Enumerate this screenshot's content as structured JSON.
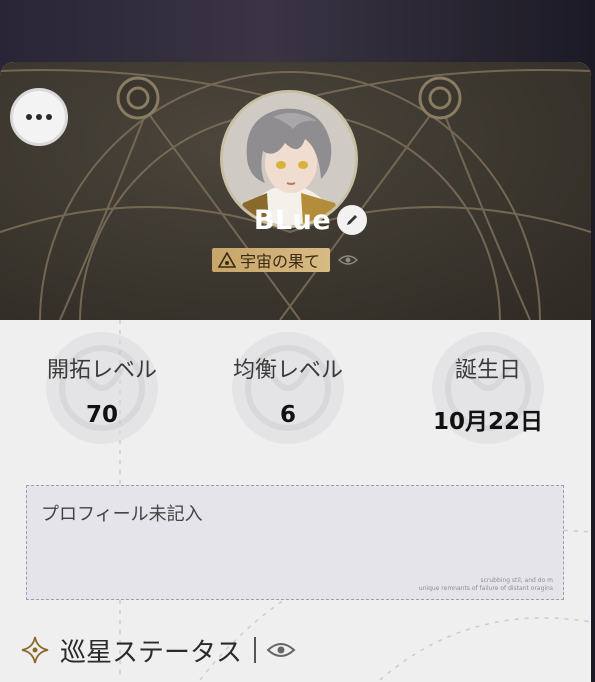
{
  "profile": {
    "name": "BLue",
    "title_badge": "宇宙の果て"
  },
  "stats": [
    {
      "label": "開拓レベル",
      "value": "70"
    },
    {
      "label": "均衡レベル",
      "value": "6"
    },
    {
      "label": "誕生日",
      "value": "10月22日"
    }
  ],
  "signature": {
    "placeholder": "プロフィール未記入",
    "micro_text_line1": "scrubbing stil, and do m",
    "micro_text_line2": "unique remnants of failure of distant oragins"
  },
  "section": {
    "title": "巡星ステータス"
  },
  "icons": {
    "more": "more-options-icon",
    "edit": "pencil-icon",
    "badge": "tri-emblem-icon",
    "visibility": "eye-icon",
    "section": "sparkle-icon"
  },
  "colors": {
    "header_bg": "#3b362e",
    "badge_gold": "#c7a56a",
    "panel_bg": "#efefef"
  }
}
